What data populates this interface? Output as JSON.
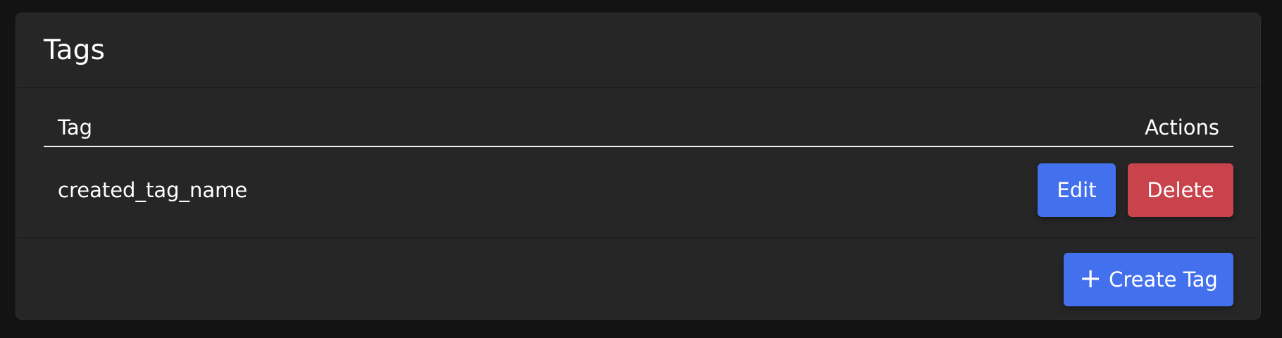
{
  "card": {
    "title": "Tags"
  },
  "table": {
    "columns": [
      "Tag",
      "Actions"
    ],
    "rows": [
      {
        "tag": "created_tag_name",
        "edit_label": "Edit",
        "delete_label": "Delete"
      }
    ]
  },
  "footer": {
    "create_label": "Create Tag",
    "create_icon": "plus-icon"
  },
  "colors": {
    "primary": "#4370ec",
    "danger": "#c9434c",
    "card_bg": "#262626",
    "page_bg": "#131313"
  }
}
